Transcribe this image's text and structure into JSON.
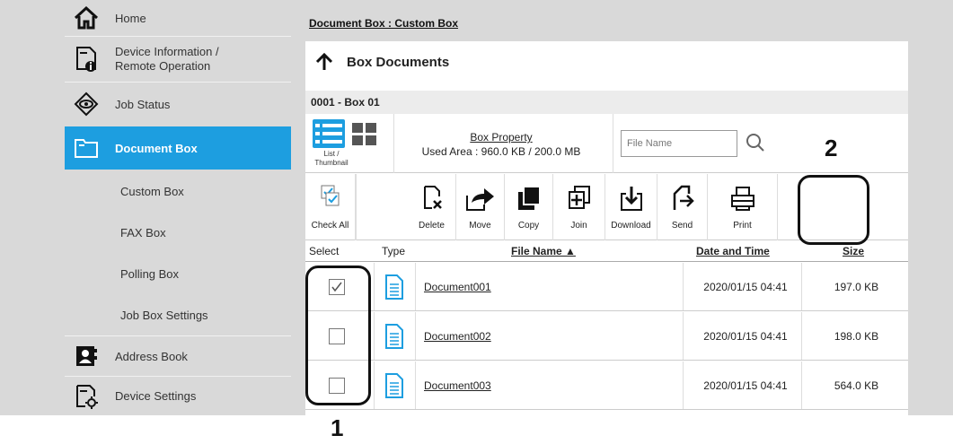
{
  "sidebar": {
    "home": "Home",
    "device_info": "Device Information /",
    "device_info_2": "Remote Operation",
    "job_status": "Job Status",
    "document_box": "Document Box",
    "custom_box": "Custom Box",
    "fax_box": "FAX Box",
    "polling_box": "Polling Box",
    "job_box_settings": "Job Box Settings",
    "address_book": "Address Book",
    "device_settings": "Device Settings"
  },
  "breadcrumb": "Document Box : Custom Box",
  "heading": "Box Documents",
  "box_name": "0001 - Box 01",
  "view": {
    "label": "List / Thumbnail"
  },
  "property": {
    "link": "Box Property",
    "used_area": "Used Area : 960.0 KB / 200.0 MB"
  },
  "search": {
    "placeholder": "File Name"
  },
  "toolbar": {
    "check_all": "Check All",
    "delete": "Delete",
    "move": "Move",
    "copy": "Copy",
    "join": "Join",
    "download": "Download",
    "send": "Send",
    "print": "Print"
  },
  "table": {
    "headers": {
      "select": "Select",
      "type": "Type",
      "file_name": "File Name ▲",
      "date": "Date and Time",
      "size": "Size"
    },
    "rows": [
      {
        "name": "Document001",
        "date": "2020/01/15 04:41",
        "size": "197.0 KB",
        "checked": true
      },
      {
        "name": "Document002",
        "date": "2020/01/15 04:41",
        "size": "198.0 KB",
        "checked": false
      },
      {
        "name": "Document003",
        "date": "2020/01/15 04:41",
        "size": "564.0 KB",
        "checked": false
      }
    ]
  },
  "callouts": {
    "one": "1",
    "two": "2"
  },
  "colors": {
    "accent": "#1d9ee0",
    "sidebar_bg": "#d9d9d9"
  }
}
